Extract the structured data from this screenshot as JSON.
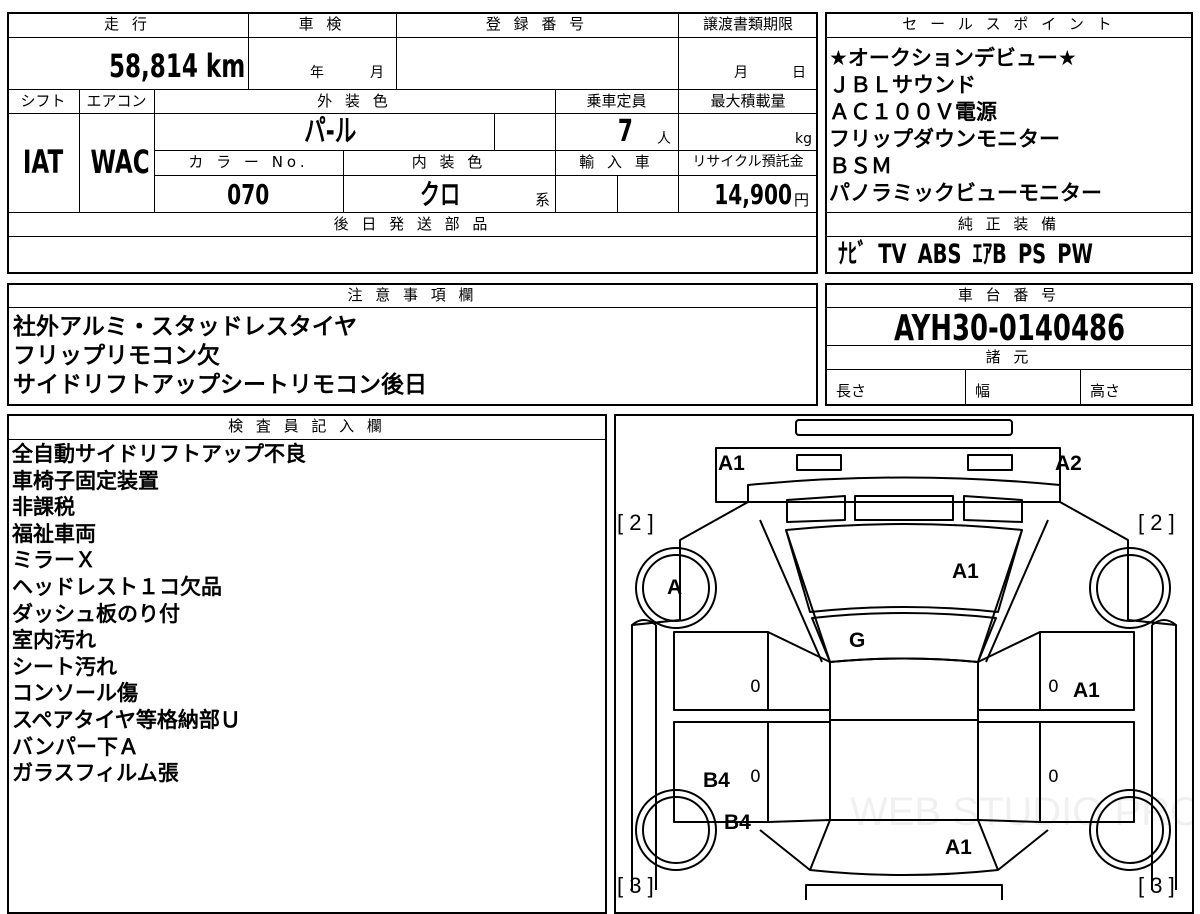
{
  "top_info": {
    "mileage_header": "走 行",
    "mileage_value": "58,814",
    "mileage_unit": "km",
    "inspection_header": "車 検",
    "inspection_year_unit": "年",
    "inspection_month_unit": "月",
    "registration_header": "登 録 番 号",
    "registration_value": "",
    "transfer_deadline_header": "譲渡書類期限",
    "transfer_month_unit": "月",
    "transfer_day_unit": "日"
  },
  "specs": {
    "shift_header": "シフト",
    "shift_value": "IAT",
    "aircon_header": "エアコン",
    "aircon_value": "WAC",
    "exterior_color_header": "外 装 色",
    "exterior_color_value": "パ-ル",
    "capacity_header": "乗車定員",
    "capacity_value": "7",
    "capacity_unit": "人",
    "max_load_header": "最大積載量",
    "max_load_unit": "kg",
    "color_no_header": "カ ラ ー No.",
    "color_no_value": "070",
    "interior_color_header": "内 装 色",
    "interior_color_value": "クロ",
    "interior_color_suffix": "系",
    "import_header": "輸 入 車",
    "recycle_header": "リサイクル預託金",
    "recycle_value": "14,900",
    "recycle_unit": "円",
    "later_parts_header": "後 日 発 送 部 品",
    "later_parts_value": ""
  },
  "sales_points": {
    "header": "セ ー ル ス ポ イ ン ト",
    "items": [
      "★オークションデビュー★",
      "ＪＢＬサウンド",
      "ＡＣ１００Ｖ電源",
      "フリップダウンモニター",
      "ＢＳＭ",
      "パノラミックビューモニター"
    ]
  },
  "genuine_equipment": {
    "header": "純 正 装 備",
    "value": "ﾅﾋﾞ TV ABS ｴｱB PS PW"
  },
  "notes": {
    "header": "注 意 事 項 欄",
    "lines": [
      "社外アルミ・スタッドレスタイヤ",
      "フリップリモコン欠",
      "サイドリフトアップシートリモコン後日"
    ]
  },
  "chassis": {
    "header": "車 台 番 号",
    "value": "AYH30-0140486"
  },
  "dimensions": {
    "header": "諸 元",
    "length_label": "長さ",
    "width_label": "幅",
    "height_label": "高さ"
  },
  "inspector": {
    "header": "検 査 員 記 入 欄",
    "lines": [
      "全自動サイドリフトアップ不良",
      "車椅子固定装置",
      "非課税",
      "福祉車両",
      "ミラーＸ",
      "ヘッドレスト１コ欠品",
      "ダッシュ板のり付",
      "室内汚れ",
      "シート汚れ",
      "コンソール傷",
      "スペアタイヤ等格納部Ｕ",
      "バンパー下Ａ",
      "ガラスフィルム張"
    ]
  },
  "diagram": {
    "bracket_top_left": "[ 2 ]",
    "bracket_top_right": "[ 2 ]",
    "bracket_bottom_left": "[ 3 ]",
    "bracket_bottom_right": "[ 3 ]",
    "wheel_front_left_mark": "A",
    "mark_front_bumper_left": "A1",
    "mark_front_bumper_right": "A2",
    "mark_hood": "A1",
    "mark_windshield": "G",
    "mark_right_door": "A1",
    "mark_left_rear_door": "B4",
    "mark_left_rear_quarter": "B4",
    "mark_roof_rear": "A1",
    "door_mark_zero": "0",
    "watermark": "WEB STUDIO PRO"
  }
}
